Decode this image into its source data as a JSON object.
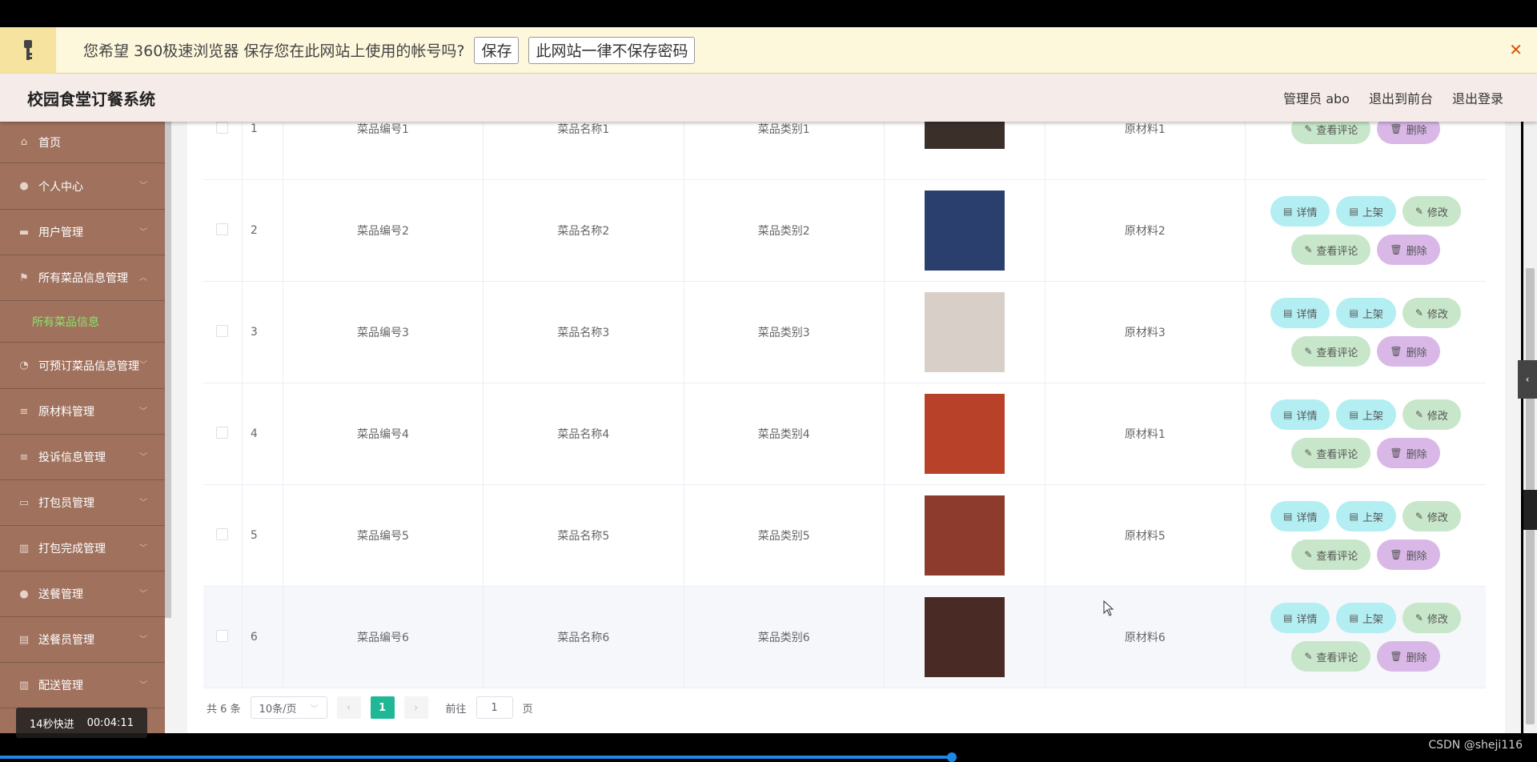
{
  "password_bar": {
    "message": "您希望 360极速浏览器 保存您在此网站上使用的帐号吗?",
    "save_label": "保存",
    "never_label": "此网站一律不保存密码",
    "close": "✕"
  },
  "header": {
    "title": "校园食堂订餐系统",
    "user": "管理员 abo",
    "front_link": "退出到前台",
    "logout_link": "退出登录"
  },
  "sidebar": {
    "items": [
      {
        "label": "首页",
        "icon": "home-icon",
        "glyph": "⌂"
      },
      {
        "label": "个人中心",
        "icon": "user-icon",
        "glyph": "●"
      },
      {
        "label": "用户管理",
        "icon": "doc-icon",
        "glyph": "▬"
      },
      {
        "label": "所有菜品信息管理",
        "icon": "flag-icon",
        "glyph": "⚑"
      },
      {
        "label": "可预订菜品信息管理",
        "icon": "gauge-icon",
        "glyph": "◔"
      },
      {
        "label": "原材料管理",
        "icon": "menu-icon",
        "glyph": "≡"
      },
      {
        "label": "投诉信息管理",
        "icon": "menu-icon",
        "glyph": "≡"
      },
      {
        "label": "打包员管理",
        "icon": "card-icon",
        "glyph": "▭"
      },
      {
        "label": "打包完成管理",
        "icon": "chart-icon",
        "glyph": "▥"
      },
      {
        "label": "送餐管理",
        "icon": "user-icon",
        "glyph": "●"
      },
      {
        "label": "送餐员管理",
        "icon": "clipboard-icon",
        "glyph": "▤"
      },
      {
        "label": "配送管理",
        "icon": "bar-chart-icon",
        "glyph": "▥"
      }
    ],
    "sub_active": "所有菜品信息"
  },
  "table": {
    "rows": [
      {
        "index": "1",
        "code": "菜品编号1",
        "name": "菜品名称1",
        "category": "菜品类别1",
        "material": "原材料1",
        "thumb_color": "#3b2f2a"
      },
      {
        "index": "2",
        "code": "菜品编号2",
        "name": "菜品名称2",
        "category": "菜品类别2",
        "material": "原材料2",
        "thumb_color": "#2b3f6e"
      },
      {
        "index": "3",
        "code": "菜品编号3",
        "name": "菜品名称3",
        "category": "菜品类别3",
        "material": "原材料3",
        "thumb_color": "#d8cfc8"
      },
      {
        "index": "4",
        "code": "菜品编号4",
        "name": "菜品名称4",
        "category": "菜品类别4",
        "material": "原材料1",
        "thumb_color": "#b8412a"
      },
      {
        "index": "5",
        "code": "菜品编号5",
        "name": "菜品名称5",
        "category": "菜品类别5",
        "material": "原材料5",
        "thumb_color": "#8c3b2c"
      },
      {
        "index": "6",
        "code": "菜品编号6",
        "name": "菜品名称6",
        "category": "菜品类别6",
        "material": "原材料6",
        "thumb_color": "#4a2a24"
      }
    ],
    "ops": {
      "detail": "详情",
      "shelve": "上架",
      "edit": "修改",
      "comments": "查看评论",
      "delete": "删除"
    }
  },
  "pager": {
    "total": "共 6 条",
    "page_size": "10条/页",
    "current": "1",
    "goto_prefix": "前往",
    "goto_value": "1",
    "goto_suffix": "页"
  },
  "overlay": {
    "timer_label": "14秒快进",
    "timer_time": "00:04:11",
    "watermark": "CSDN @sheji116"
  },
  "colors": {
    "sidebar": "#a0725e",
    "active_page": "#1fb796",
    "op_cyan": "#b3eef2",
    "op_green": "#c8e6c9",
    "op_purple": "#d9b8e8"
  }
}
